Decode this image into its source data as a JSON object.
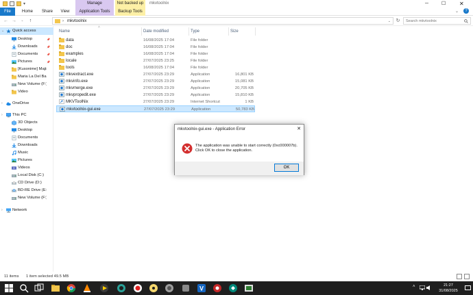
{
  "window": {
    "title": "mkvtoolnix"
  },
  "ribbon": {
    "context_groups": {
      "manage": "Manage",
      "not_backed_up": "Not backed up"
    },
    "tabs": {
      "file": "File",
      "home": "Home",
      "share": "Share",
      "view": "View",
      "application_tools": "Application Tools",
      "backup_tools": "Backup Tools"
    }
  },
  "address": {
    "path": "mkvtoolnix",
    "search_placeholder": "Search mkvtoolnix"
  },
  "sidebar": {
    "items": [
      {
        "label": "Quick access",
        "icon": "star-icon",
        "pinned": false,
        "selected": true
      },
      {
        "label": "Desktop",
        "icon": "desktop-icon",
        "pinned": true
      },
      {
        "label": "Downloads",
        "icon": "downloads-icon",
        "pinned": true
      },
      {
        "label": "Documents",
        "icon": "documents-icon",
        "pinned": true
      },
      {
        "label": "Pictures",
        "icon": "pictures-icon",
        "pinned": true
      },
      {
        "label": "[Kusonime] Majisuk",
        "icon": "folder-icon",
        "pinned": false
      },
      {
        "label": "Maria La Del Barrio",
        "icon": "folder-icon",
        "pinned": false
      },
      {
        "label": "New Volume (F:)",
        "icon": "drive-icon",
        "pinned": false
      },
      {
        "label": "Video",
        "icon": "folder-icon",
        "pinned": false
      },
      {
        "label": "OneDrive",
        "icon": "cloud-icon",
        "pinned": false
      },
      {
        "label": "This PC",
        "icon": "pc-icon",
        "pinned": false
      },
      {
        "label": "3D Objects",
        "icon": "3d-objects-icon",
        "pinned": false
      },
      {
        "label": "Desktop",
        "icon": "desktop-icon",
        "pinned": false
      },
      {
        "label": "Documents",
        "icon": "documents-icon",
        "pinned": false
      },
      {
        "label": "Downloads",
        "icon": "downloads-icon",
        "pinned": false
      },
      {
        "label": "Music",
        "icon": "music-icon",
        "pinned": false
      },
      {
        "label": "Pictures",
        "icon": "pictures-icon",
        "pinned": false
      },
      {
        "label": "Videos",
        "icon": "videos-icon",
        "pinned": false
      },
      {
        "label": "Local Disk (C:)",
        "icon": "drive-icon",
        "pinned": false
      },
      {
        "label": "CD Drive (D:)",
        "icon": "cd-drive-icon",
        "pinned": false
      },
      {
        "label": "BD-RE Drive (E:)",
        "icon": "bd-drive-icon",
        "pinned": false
      },
      {
        "label": "New Volume (F:)",
        "icon": "drive-icon",
        "pinned": false
      },
      {
        "label": "Network",
        "icon": "network-icon",
        "pinned": false
      }
    ]
  },
  "columns": {
    "name": "Name",
    "date": "Date modified",
    "type": "Type",
    "size": "Size"
  },
  "files": [
    {
      "name": "data",
      "date": "16/08/2025 17:04",
      "type": "File folder",
      "size": "",
      "icon": "folder-icon"
    },
    {
      "name": "doc",
      "date": "16/08/2025 17:04",
      "type": "File folder",
      "size": "",
      "icon": "folder-icon"
    },
    {
      "name": "examples",
      "date": "16/08/2025 17:04",
      "type": "File folder",
      "size": "",
      "icon": "folder-icon"
    },
    {
      "name": "locale",
      "date": "27/07/2025 23:25",
      "type": "File folder",
      "size": "",
      "icon": "folder-icon"
    },
    {
      "name": "tools",
      "date": "16/08/2025 17:04",
      "type": "File folder",
      "size": "",
      "icon": "folder-icon"
    },
    {
      "name": "mkvextract.exe",
      "date": "27/07/2025 23:29",
      "type": "Application",
      "size": "16,801 KB",
      "icon": "application-icon"
    },
    {
      "name": "mkvinfo.exe",
      "date": "27/07/2025 23:29",
      "type": "Application",
      "size": "15,081 KB",
      "icon": "application-icon"
    },
    {
      "name": "mkvmerge.exe",
      "date": "27/07/2025 23:29",
      "type": "Application",
      "size": "20,705 KB",
      "icon": "application-icon"
    },
    {
      "name": "mkvpropedit.exe",
      "date": "27/07/2025 23:29",
      "type": "Application",
      "size": "15,810 KB",
      "icon": "application-icon"
    },
    {
      "name": "MKVToolNix",
      "date": "27/07/2025 23:29",
      "type": "Internet Shortcut",
      "size": "1 KB",
      "icon": "shortcut-icon"
    },
    {
      "name": "mkvtoolnix-gui.exe",
      "date": "27/07/2025 23:29",
      "type": "Application",
      "size": "50,783 KB",
      "icon": "application-icon",
      "selected": true
    }
  ],
  "status": {
    "count": "11 items",
    "selection": "1 item selected  49.5 MB"
  },
  "dialog": {
    "title": "mkvtoolnix-gui.exe - Application Error",
    "message": "The application was unable to start correctly (0xc000007b).\nClick OK to close the application.",
    "ok_label": "OK"
  },
  "taskbar": {
    "time": "21:27",
    "date": "31/08/2025"
  },
  "colors": {
    "accent": "#1979ca",
    "selection": "#cce8ff",
    "folder": "#f3c64c",
    "manage_tab": "#d9c8f0",
    "backup_tab": "#fdf0a6",
    "taskbar": "#1f1f1f",
    "error": "#d32f2f"
  }
}
